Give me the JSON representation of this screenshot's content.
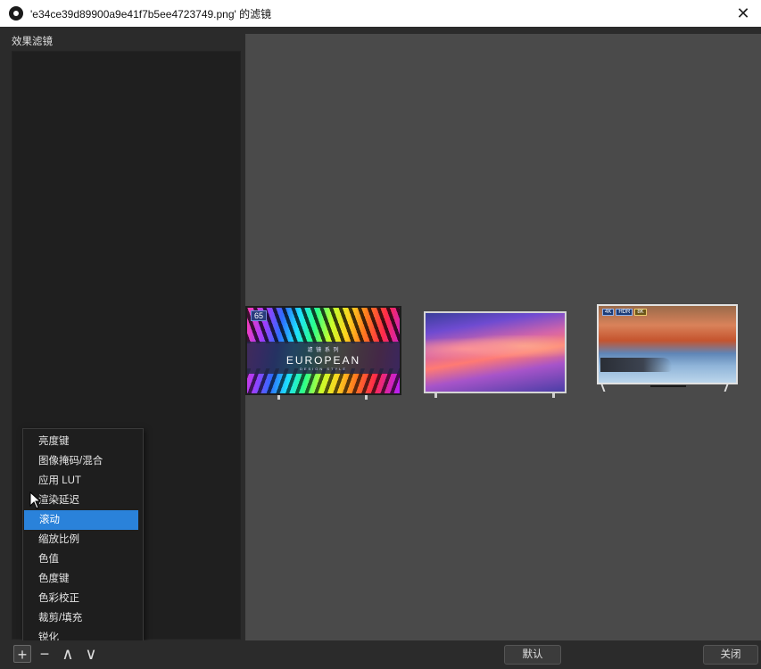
{
  "window": {
    "title": "'e34ce39d89900a9e41f7b5ee4723749.png' 的滤镜"
  },
  "panel": {
    "header": "效果滤镜"
  },
  "preview": {
    "tv1": {
      "badge": "65",
      "brand_small": "滤 镜 系 列",
      "brand_big": "EUROPEAN",
      "brand_tiny": "DESIGN STYLE"
    },
    "tv3": {
      "tags": [
        "4K",
        "HDR",
        "8K"
      ]
    }
  },
  "context_menu": {
    "items": [
      {
        "label": "亮度键",
        "active": false
      },
      {
        "label": "图像掩码/混合",
        "active": false
      },
      {
        "label": "应用 LUT",
        "active": false
      },
      {
        "label": "渲染延迟",
        "active": false
      },
      {
        "label": "滚动",
        "active": true
      },
      {
        "label": "缩放比例",
        "active": false
      },
      {
        "label": "色值",
        "active": false
      },
      {
        "label": "色度键",
        "active": false
      },
      {
        "label": "色彩校正",
        "active": false
      },
      {
        "label": "裁剪/填充",
        "active": false
      },
      {
        "label": "锐化",
        "active": false
      }
    ]
  },
  "toolbar": {
    "add_icon": "+",
    "remove_icon": "−",
    "up_icon": "∧",
    "down_icon": "∨"
  },
  "buttons": {
    "default_label": "默认",
    "close_label": "关闭"
  },
  "colors": {
    "accent": "#2a82da",
    "preview_bg": "#4a4a4a",
    "panel_bg": "#1f1f1f"
  }
}
